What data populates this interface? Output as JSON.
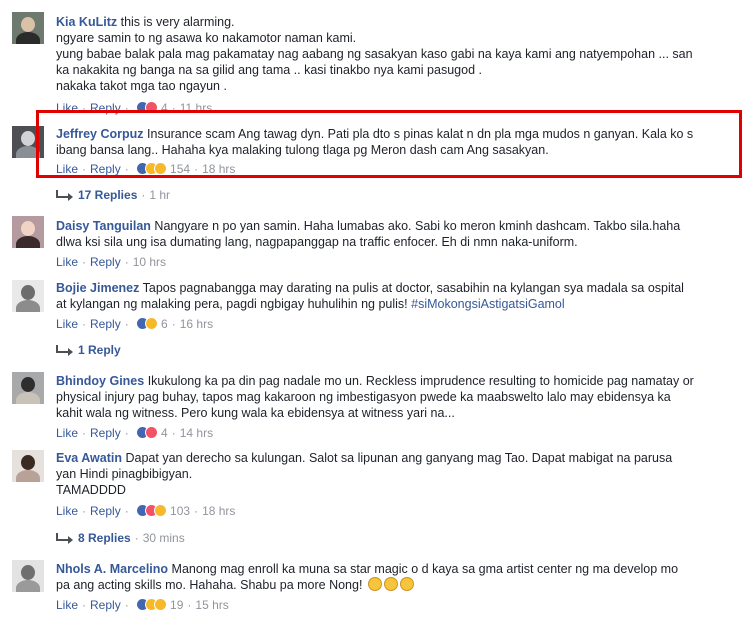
{
  "colors": {
    "link": "#365899",
    "meta": "#90949c",
    "highlight": "#e00000"
  },
  "comments": [
    {
      "name": "Kia KuLitz",
      "lines": [
        "this is very alarming.",
        "ngyare samin to ng asawa ko nakamotor naman kami.",
        "yung babae balak pala mag pakamatay nag aabang ng sasakyan kaso gabi na kaya kami ang natyempohan ... san",
        "ka nakakita ng banga na sa gilid ang tama .. kasi tinakbo nya kami pasugod .",
        "nakaka takot mga tao ngayun ."
      ],
      "like": "Like",
      "reply": "Reply",
      "react_count": "4",
      "time": "11 hrs"
    },
    {
      "name": "Jeffrey Corpuz",
      "lines": [
        "Insurance scam Ang tawag dyn. Pati pla dto s pinas kalat n dn pla mga mudos n ganyan. Kala ko s",
        "ibang bansa lang.. Hahaha kya malaking tulong tlaga pg Meron dash cam Ang sasakyan."
      ],
      "like": "Like",
      "reply": "Reply",
      "react_count": "154",
      "time": "18 hrs",
      "replies": "17 Replies",
      "replies_time": "1 hr"
    },
    {
      "name": "Daisy Tanguilan",
      "lines": [
        "Nangyare n po yan samin. Haha lumabas ako. Sabi ko meron kminh dashcam. Takbo sila.haha",
        "dlwa ksi sila ung isa dumating lang, nagpapanggap na traffic enfocer. Eh di nmn naka-uniform."
      ],
      "like": "Like",
      "reply": "Reply",
      "time": "10 hrs"
    },
    {
      "name": "Bojie Jimenez",
      "lines": [
        "Tapos pagnabangga may darating na pulis at doctor, sasabihin na kylangan sya madala sa ospital",
        "at kylangan ng malaking pera, pagdi ngbigay huhulihin ng pulis!"
      ],
      "hashtag": "#siMokongsiAstigatsiGamol",
      "like": "Like",
      "reply": "Reply",
      "react_count": "6",
      "time": "16 hrs",
      "replies": "1 Reply"
    },
    {
      "name": "Bhindoy Gines",
      "lines": [
        "Ikukulong ka pa din pag nadale mo un. Reckless imprudence resulting to homicide pag namatay or",
        "physical injury pag buhay, tapos mag kakaroon ng imbestigasyon pwede ka maabswelto lalo may ebidensya ka",
        "kahit wala ng witness. Pero kung wala ka ebidensya at witness yari na..."
      ],
      "like": "Like",
      "reply": "Reply",
      "react_count": "4",
      "time": "14 hrs"
    },
    {
      "name": "Eva Awatin",
      "lines": [
        "Dapat yan derecho sa kulungan. Salot sa lipunan ang ganyang mag Tao. Dapat mabigat na parusa",
        "yan Hindi pinagbibigyan.",
        "TAMADDDD"
      ],
      "like": "Like",
      "reply": "Reply",
      "react_count": "103",
      "time": "18 hrs",
      "replies": "8 Replies",
      "replies_time": "30 mins"
    },
    {
      "name": "Nhols A. Marcelino",
      "lines": [
        "Manong mag enroll ka muna sa star magic o d kaya sa gma artist center ng ma develop mo",
        "pa ang acting skills mo. Hahaha. Shabu pa more Nong!"
      ],
      "like": "Like",
      "reply": "Reply",
      "react_count": "19",
      "time": "15 hrs"
    }
  ]
}
